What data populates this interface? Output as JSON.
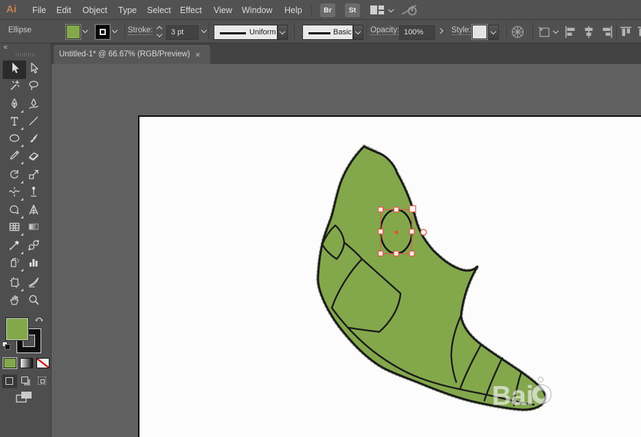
{
  "menu_bar": {
    "logo_text": "Ai",
    "items": [
      "File",
      "Edit",
      "Object",
      "Type",
      "Select",
      "Effect",
      "View",
      "Window",
      "Help"
    ],
    "bridge_button": "Br",
    "stock_button": "St"
  },
  "control_bar": {
    "tool_context_label": "Ellipse",
    "stroke_label": "Stroke:",
    "stroke_weight": "3 pt",
    "width_profile": "Uniform",
    "brush": "Basic",
    "opacity_label": "Opacity:",
    "opacity_value": "100%",
    "style_label": "Style:"
  },
  "document_tab": {
    "title": "Untitled-1* @ 66.67% (RGB/Preview)",
    "close_glyph": "×"
  },
  "tools_panel": {
    "collapse_glyph": "«",
    "active_tool": "selection",
    "tools": [
      "selection",
      "direct-selection",
      "magic-wand",
      "lasso",
      "pen",
      "curvature",
      "type",
      "line-segment",
      "ellipse",
      "paintbrush",
      "pencil",
      "eraser",
      "rotate",
      "scale",
      "width",
      "puppet-warp",
      "shaper",
      "perspective-grid",
      "mesh",
      "gradient",
      "eyedropper",
      "blend",
      "symbol-sprayer",
      "column-graph",
      "artboard",
      "slice",
      "hand",
      "zoom"
    ],
    "fill_color": "#83a84c",
    "stroke_color": "#000000"
  },
  "artwork": {
    "description": "green cocoon pokemon line drawing with ellipse being drawn",
    "fill_color": "#83a84c",
    "outline_color": "#1b1b1b"
  },
  "selection": {
    "accent_color": "#d95f4c",
    "handle_fill": "#fdeeea"
  },
  "watermark": {
    "text": "Bai"
  }
}
